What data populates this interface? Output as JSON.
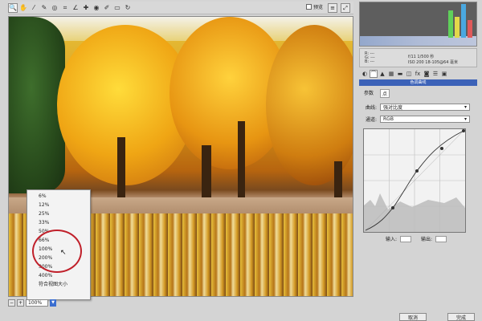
{
  "toolbar": {
    "tools": [
      "magnifier-icon",
      "hand-icon",
      "eyedropper-icon",
      "color-sampler-icon",
      "target-adjust-icon",
      "crop-icon",
      "straighten-icon",
      "retouch-icon",
      "red-eye-icon",
      "brush-icon",
      "gradient-icon",
      "rotate-icon"
    ],
    "tool_glyphs": [
      "🔍",
      "✋",
      "⁄",
      "✎",
      "◎",
      "⌗",
      "∠",
      "✚",
      "◉",
      "✐",
      "▭",
      "↻"
    ],
    "preview_label": "预览"
  },
  "zoom_menu": {
    "items": [
      "6%",
      "12%",
      "25%",
      "33%",
      "50%",
      "66%",
      "100%",
      "200%",
      "300%",
      "400%",
      "符合视图大小"
    ],
    "highlighted": "100%"
  },
  "statusbar": {
    "zoom_value": "100%"
  },
  "info": {
    "r": "R: ---",
    "g": "G: ---",
    "b": "B: ---",
    "line1": "f/11  1/500 秒",
    "line2": "ISO 200  18-105@64 毫米"
  },
  "panel": {
    "title": "色调曲线",
    "sub_tabs": [
      "参数",
      "点"
    ],
    "curve_label": "曲线:",
    "curve_value": "强对比度",
    "channel_label": "通道:",
    "channel_value": "RGB",
    "input_label": "输入:",
    "output_label": "输出:"
  },
  "buttons": {
    "cancel": "取消",
    "done": "完成"
  },
  "colors": {
    "accent": "#3c62b8",
    "highlight_circle": "#c0202a"
  }
}
